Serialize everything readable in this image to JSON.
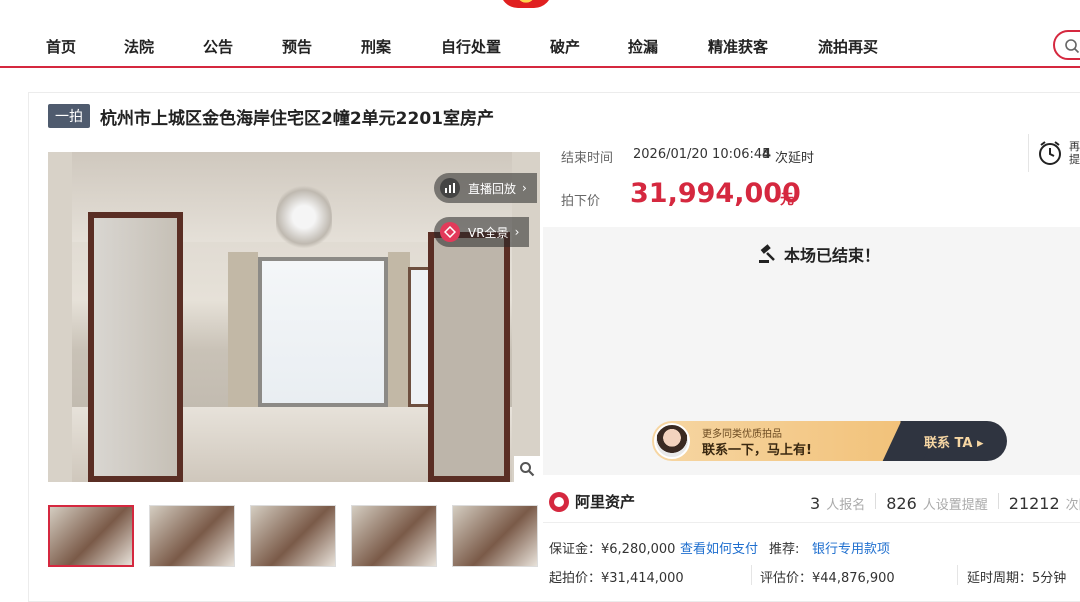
{
  "nav": {
    "items": [
      "首页",
      "法院",
      "公告",
      "预告",
      "刑案",
      "自行处置",
      "破产",
      "捡漏",
      "精准获客",
      "流拍再买"
    ]
  },
  "item": {
    "tag": "一拍",
    "title": "杭州市上城区金色海岸住宅区2幢2单元2201室房产"
  },
  "media": {
    "live_replay": "直播回放",
    "vr": "VR全景"
  },
  "auction": {
    "end_time_label": "结束时间",
    "end_time": "2026/01/20 10:06:45",
    "extend_count": "4",
    "extend_suffix": "次延时",
    "price_label": "拍下价",
    "price": "31,994,000",
    "price_unit": "元",
    "reminder": "再\n提",
    "ended_text": "本场已结束！"
  },
  "banner": {
    "line1": "更多同类优质拍品",
    "line2": "联系一下，马上有!",
    "cta": "联系 TA"
  },
  "brand": {
    "name": "阿里资产"
  },
  "stats": {
    "signups_num": "3",
    "signups_label": "人报名",
    "reminders_num": "826",
    "reminders_label": "人设置提醒",
    "views_num": "21212",
    "views_label": "次围"
  },
  "details": {
    "deposit": "保证金：¥6,280,000",
    "how_to_pay": "查看如何支付",
    "recommend_label": "推荐:",
    "bank_loan": "银行专用款项",
    "start_price": "起拍价：¥31,414,000",
    "appraisal": "评估价：¥44,876,900",
    "delay_period": "延时周期：5分钟"
  },
  "colors": {
    "accent": "#d5283f",
    "link": "#1f6fcf",
    "tag_bg": "#4f5b6e"
  }
}
